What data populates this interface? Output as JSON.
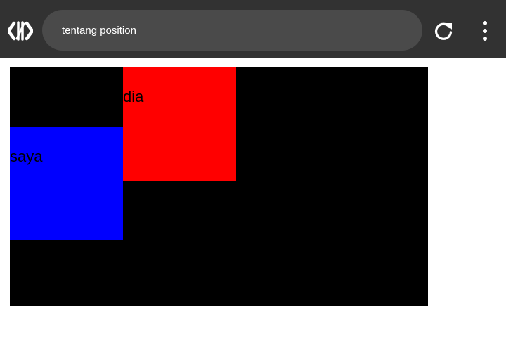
{
  "browser": {
    "address_text": "tentang position",
    "logo_icon": "code-brackets-icon",
    "reload_icon": "reload-icon",
    "menu_icon": "more-vert-icon",
    "toolbar_color": "#323232",
    "address_bar_color": "#4a4a4a"
  },
  "page": {
    "container_color": "#000000",
    "boxes": [
      {
        "label": "saya",
        "color": "#0000ff"
      },
      {
        "label": "dia",
        "color": "#ff0000"
      }
    ]
  }
}
